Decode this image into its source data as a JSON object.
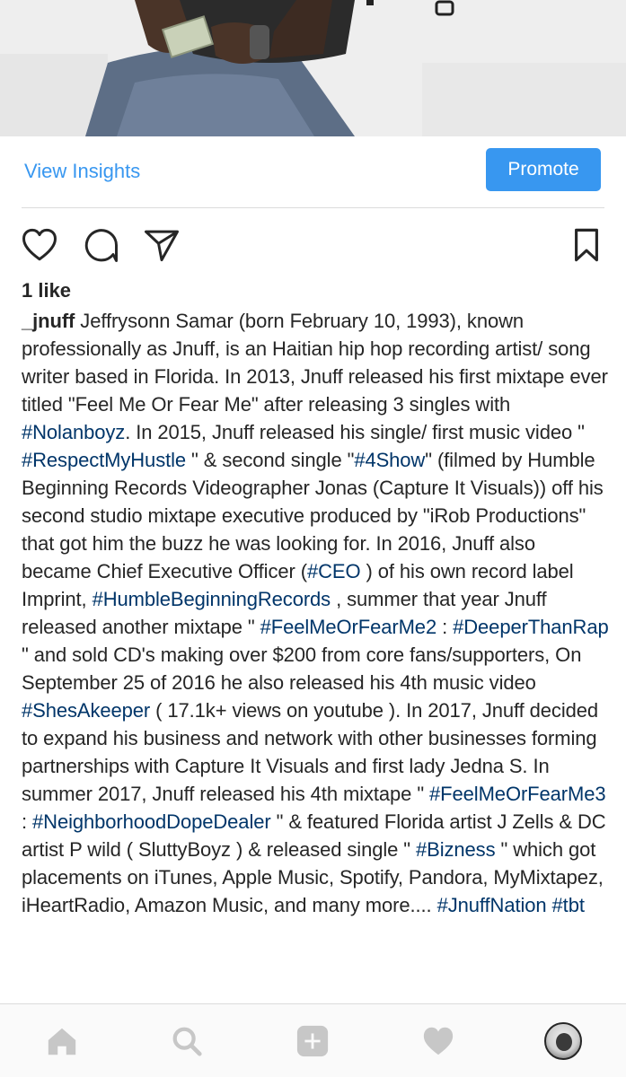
{
  "post": {
    "view_insights_label": "View Insights",
    "promote_label": "Promote",
    "likes_text": "1 like",
    "caption": {
      "username": "_jnuff",
      "segments": [
        {
          "type": "text",
          "value": " Jeffrysonn Samar (born February 10, 1993), known professionally as Jnuff, is an Haitian hip hop recording artist/ song writer based in Florida. In 2013, Jnuff released his first mixtape ever titled \"Feel Me Or Fear Me\" after releasing 3 singles with "
        },
        {
          "type": "tag",
          "value": "#Nolanboyz"
        },
        {
          "type": "text",
          "value": ". In 2015, Jnuff released his single/ first music video \" "
        },
        {
          "type": "tag",
          "value": "#RespectMyHustle"
        },
        {
          "type": "text",
          "value": " \" & second single \""
        },
        {
          "type": "tag",
          "value": "#4Show"
        },
        {
          "type": "text",
          "value": "\" (filmed by Humble Beginning Records Videographer Jonas (Capture It Visuals)) off his second studio mixtape executive produced by \"iRob Productions\" that got him the buzz he was looking for. In 2016, Jnuff also became Chief Executive Officer ("
        },
        {
          "type": "tag",
          "value": "#CEO"
        },
        {
          "type": "text",
          "value": " ) of his own record label Imprint, "
        },
        {
          "type": "tag",
          "value": "#HumbleBeginningRecords"
        },
        {
          "type": "text",
          "value": " , summer that year Jnuff released another mixtape \" "
        },
        {
          "type": "tag",
          "value": "#FeelMeOrFearMe2"
        },
        {
          "type": "text",
          "value": " : "
        },
        {
          "type": "tag",
          "value": "#DeeperThanRap"
        },
        {
          "type": "text",
          "value": " \" and sold CD's making over $200 from core fans/supporters, On September 25 of 2016 he also released his 4th music video "
        },
        {
          "type": "tag",
          "value": "#ShesAkeeper"
        },
        {
          "type": "text",
          "value": " ( 17.1k+ views on youtube ). In 2017, Jnuff decided to expand his business and network with other businesses forming partnerships with Capture It Visuals and first lady Jedna S. In summer 2017, Jnuff released his 4th mixtape \" "
        },
        {
          "type": "tag",
          "value": "#FeelMeOrFearMe3"
        },
        {
          "type": "text",
          "value": " : "
        },
        {
          "type": "tag",
          "value": "#NeighborhoodDopeDealer"
        },
        {
          "type": "text",
          "value": " \" & featured Florida artist J Zells & DC artist P wild ( SluttyBoyz ) & released single \" "
        },
        {
          "type": "tag",
          "value": "#Bizness"
        },
        {
          "type": "text",
          "value": " \" which got placements on iTunes, Apple Music, Spotify, Pandora, MyMixtapez, iHeartRadio, Amazon Music, and many more.... "
        },
        {
          "type": "tag",
          "value": "#JnuffNation"
        },
        {
          "type": "text",
          "value": " "
        },
        {
          "type": "tag",
          "value": "#tbt"
        }
      ]
    }
  },
  "actions": {
    "icons": [
      "heart-icon",
      "comment-icon",
      "share-icon",
      "bookmark-icon"
    ]
  },
  "bottom_nav": {
    "icons": [
      "home-icon",
      "search-icon",
      "add-icon",
      "activity-heart-icon",
      "profile-avatar"
    ]
  },
  "colors": {
    "accent": "#3897f0",
    "hashtag": "#003569",
    "text": "#262626",
    "nav_icon": "#c7c7c7",
    "nav_bg": "#fafafa",
    "divider": "#dbdbdb"
  }
}
